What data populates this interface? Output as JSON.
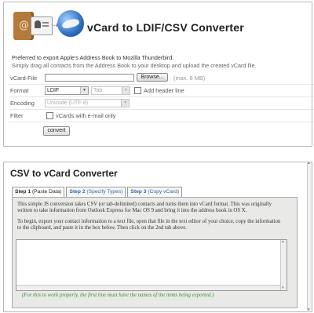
{
  "top": {
    "title": "vCard to LDIF/CSV Converter",
    "desc_line1": "Preferred to export Apple's Address Book to Mozilla Thunderbird.",
    "desc_line2": "Simply drag all contacts from the Address Book to your desktop and upload the created vCard file.",
    "form": {
      "vcard_label": "vCard-File",
      "browse_label": "Browse...",
      "max_note": "(max. 8 MB)",
      "format_label": "Format",
      "format_value": "LDIF",
      "separator_value": "Tab",
      "header_line_label": "Add header line",
      "encoding_label": "Encoding",
      "encoding_value": "Unicode (UTF-8)",
      "filter_label": "Filter",
      "filter_option_label": "vCards with e-mail only",
      "convert_label": "convert"
    }
  },
  "bottom": {
    "title": "CSV to vCard Converter",
    "tabs": [
      {
        "step": "Step 1",
        "name": "(Paste Data)"
      },
      {
        "step": "Step 2",
        "name": "(Specify Types)"
      },
      {
        "step": "Step 3",
        "name": "(Copy vCard)"
      }
    ],
    "para1": "This simple JS conversion takes CSV (or tab-delimited) contacts and turns them into vCard format. This was originally written to take information from Outlook Express for Mac OS 9 and bring it into the address book in OS X.",
    "para2": "To begin, export your contact information to a text file, open that file in the text editor of your choice, copy the information to the clipboard, and paste it in the box below. Then click on the 2nd tab above.",
    "textarea_value": "",
    "note": "(For this to work properly, the first line must have the names of the items being exported.)"
  },
  "icons": [
    "address-book-icon",
    "contact-card-icon",
    "arrow-icon",
    "thunderbird-icon"
  ]
}
